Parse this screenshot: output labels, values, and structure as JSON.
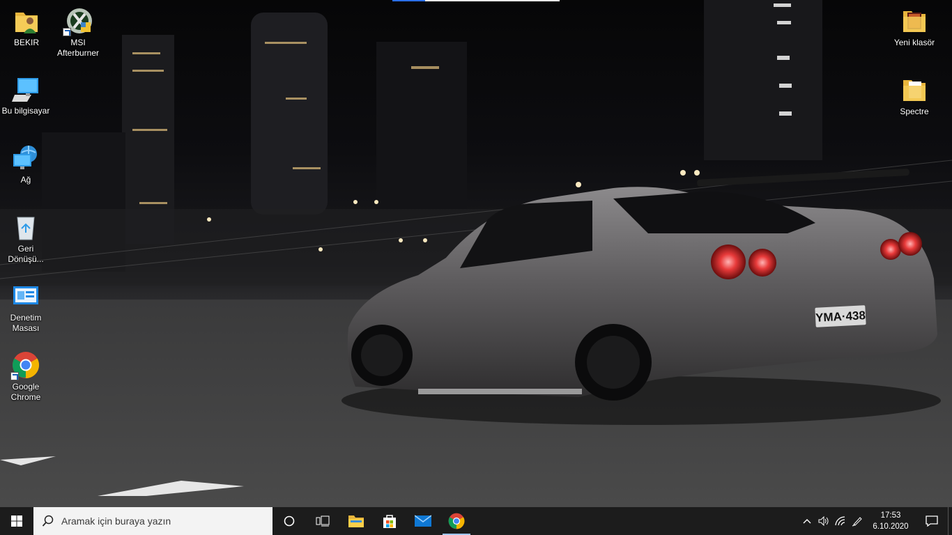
{
  "desktop": {
    "left_icons": [
      {
        "name": "bekir-folder",
        "label": "BEKIR",
        "icon": "user-folder-icon",
        "shortcut": false
      },
      {
        "name": "msi-afterburner",
        "label": "MSI Afterburner",
        "icon": "msi-afterburner-icon",
        "shortcut": true
      },
      {
        "name": "this-pc",
        "label": "Bu bilgisayar",
        "icon": "computer-icon",
        "shortcut": false
      },
      {
        "name": "network",
        "label": "Ağ",
        "icon": "network-icon",
        "shortcut": false
      },
      {
        "name": "recycle-bin",
        "label": "Geri Dönüşü...",
        "icon": "recycle-bin-icon",
        "shortcut": false
      },
      {
        "name": "control-panel",
        "label": "Denetim Masası",
        "icon": "control-panel-icon",
        "shortcut": false
      },
      {
        "name": "google-chrome",
        "label": "Google Chrome",
        "icon": "chrome-icon",
        "shortcut": true
      }
    ],
    "right_icons": [
      {
        "name": "new-folder",
        "label": "Yeni klasör",
        "icon": "folder-icon"
      },
      {
        "name": "spectre-folder",
        "label": "Spectre",
        "icon": "folder-icon"
      }
    ],
    "wallpaper": {
      "license_plate": "YMA·438"
    }
  },
  "taskbar": {
    "search_placeholder": "Aramak için buraya yazın",
    "pinned": [
      {
        "name": "cortana",
        "icon": "cortana-circle-icon"
      },
      {
        "name": "task-view",
        "icon": "task-view-icon"
      },
      {
        "name": "file-explorer",
        "icon": "file-explorer-icon"
      },
      {
        "name": "microsoft-store",
        "icon": "store-icon"
      },
      {
        "name": "mail",
        "icon": "mail-icon"
      },
      {
        "name": "chrome",
        "icon": "chrome-icon",
        "active": true
      }
    ],
    "tray": {
      "time": "17:53",
      "date": "6.10.2020"
    }
  },
  "colors": {
    "taskbar": "#1c1c1c",
    "accent": "#2a6ee8",
    "search_bg": "#f3f3f3"
  }
}
